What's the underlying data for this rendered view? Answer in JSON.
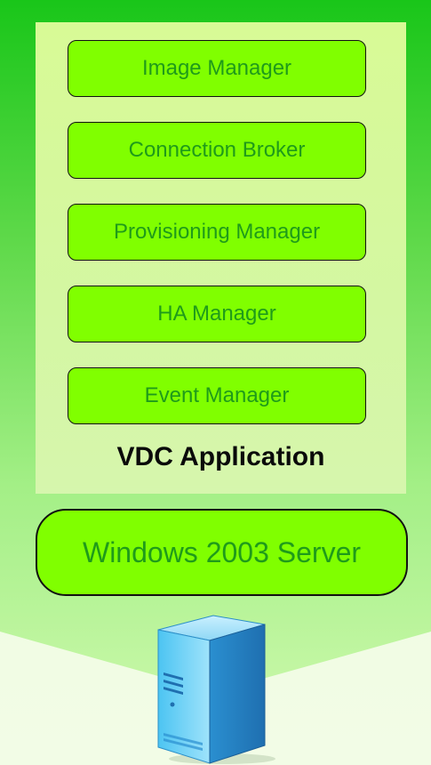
{
  "colors": {
    "outer_top": "#1ec81a",
    "outer_bottom": "#bff7a0",
    "panel": "#d8fa96",
    "module_fill": "#80ff00",
    "module_text": "#1f9b1a",
    "title_text": "#0a0a0a"
  },
  "application": {
    "title": "VDC Application",
    "modules": [
      {
        "label": "Image Manager"
      },
      {
        "label": "Connection Broker"
      },
      {
        "label": "Provisioning Manager"
      },
      {
        "label": "HA Manager"
      },
      {
        "label": "Event Manager"
      }
    ]
  },
  "os": {
    "label": "Windows 2003 Server"
  },
  "server": {
    "icon": "server-tower-icon"
  }
}
